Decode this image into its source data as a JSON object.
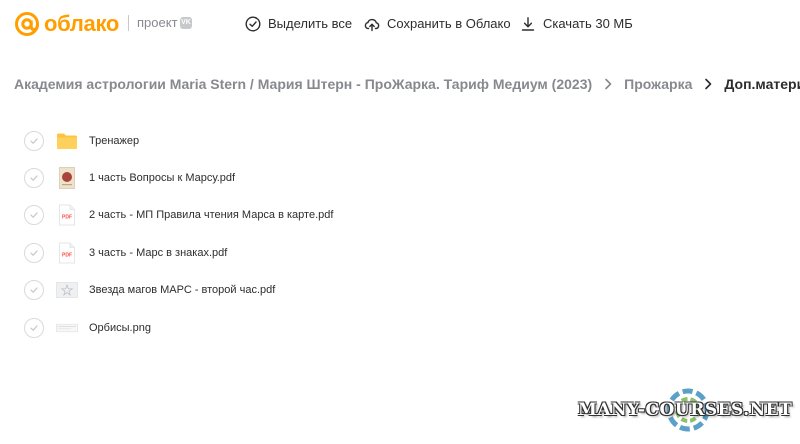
{
  "header": {
    "logo_text": "облако",
    "project_label": "проект",
    "vk_badge": "VK",
    "actions": {
      "select_all": "Выделить все",
      "save_to_cloud": "Сохранить в Облако",
      "download": "Скачать 30 МБ"
    }
  },
  "breadcrumb": {
    "items": [
      "Академия астрологии Maria Stern / Мария Штерн - ПроЖарка. Тариф Медиум (2023)",
      "Прожарка",
      "Доп.материалы"
    ]
  },
  "files": [
    {
      "name": "Тренажер",
      "kind": "folder"
    },
    {
      "name": "1 часть Вопросы к Марсу.pdf",
      "kind": "pdf-image"
    },
    {
      "name": "2 часть - МП Правила чтения Марса в карте.pdf",
      "kind": "pdf",
      "badge": "PDF"
    },
    {
      "name": "3 часть - Марс в знаках.pdf",
      "kind": "pdf",
      "badge": "PDF"
    },
    {
      "name": "Звезда магов МАРС - второй час.pdf",
      "kind": "pdf-image"
    },
    {
      "name": "Орбисы.png",
      "kind": "png"
    }
  ],
  "watermark": "MANY-COURSES.NET",
  "colors": {
    "brand": "#ff9e00",
    "text": "#2c2d2e",
    "muted": "#87898f",
    "pdf_red": "#ff4a3d",
    "folder": "#ffc340"
  }
}
